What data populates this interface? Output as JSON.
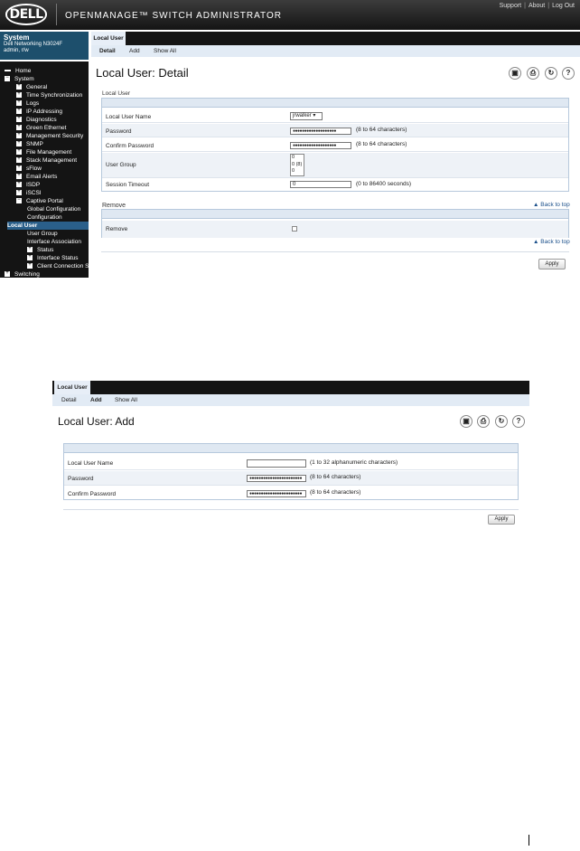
{
  "detail_screen": {
    "header": {
      "logo": "DELL",
      "product_title": "OPENMANAGE™ SWITCH ADMINISTRATOR",
      "links": [
        "Support",
        "About",
        "Log Out"
      ]
    },
    "system_box": {
      "title": "System",
      "device": "Dell Networking N3024F",
      "user": "admin, r/w"
    },
    "nav": [
      {
        "label": "Home",
        "indent": 0,
        "marker": "dash"
      },
      {
        "label": "System",
        "indent": 0,
        "marker": "minus"
      },
      {
        "label": "General",
        "indent": 1,
        "marker": "plus"
      },
      {
        "label": "Time Synchronization",
        "indent": 1,
        "marker": "plus"
      },
      {
        "label": "Logs",
        "indent": 1,
        "marker": "plus"
      },
      {
        "label": "IP Addressing",
        "indent": 1,
        "marker": "plus"
      },
      {
        "label": "Diagnostics",
        "indent": 1,
        "marker": "plus"
      },
      {
        "label": "Green Ethernet",
        "indent": 1,
        "marker": "plus"
      },
      {
        "label": "Management Security",
        "indent": 1,
        "marker": "plus"
      },
      {
        "label": "SNMP",
        "indent": 1,
        "marker": "plus"
      },
      {
        "label": "File Management",
        "indent": 1,
        "marker": "plus"
      },
      {
        "label": "Stack Management",
        "indent": 1,
        "marker": "plus"
      },
      {
        "label": "sFlow",
        "indent": 1,
        "marker": "plus"
      },
      {
        "label": "Email Alerts",
        "indent": 1,
        "marker": "plus"
      },
      {
        "label": "ISDP",
        "indent": 1,
        "marker": "plus"
      },
      {
        "label": "iSCSI",
        "indent": 1,
        "marker": "plus"
      },
      {
        "label": "Captive Portal",
        "indent": 1,
        "marker": "minus"
      },
      {
        "label": "Global Configuration",
        "indent": 2,
        "marker": "none"
      },
      {
        "label": "Configuration",
        "indent": 2,
        "marker": "none"
      },
      {
        "label": "Local User",
        "indent": 2,
        "marker": "none",
        "selected": true
      },
      {
        "label": "User Group",
        "indent": 2,
        "marker": "none"
      },
      {
        "label": "Interface Association",
        "indent": 2,
        "marker": "none"
      },
      {
        "label": "Status",
        "indent": 2,
        "marker": "plus"
      },
      {
        "label": "Interface Status",
        "indent": 2,
        "marker": "plus"
      },
      {
        "label": "Client Connection Status",
        "indent": 2,
        "marker": "plus"
      },
      {
        "label": "Switching",
        "indent": 0,
        "marker": "plus"
      }
    ],
    "tab": "Local User",
    "subtabs": [
      "Detail",
      "Add",
      "Show All"
    ],
    "page_title": "Local User: Detail",
    "section_title": "Local User",
    "fields": {
      "name_label": "Local User Name",
      "name_value": "jrwalker",
      "password_label": "Password",
      "password_hint": "(8 to 64 characters)",
      "confirm_label": "Confirm Password",
      "confirm_hint": "(8 to 64 characters)",
      "group_label": "User Group",
      "group_options": [
        "0",
        "0 (8)",
        "0"
      ],
      "timeout_label": "Session Timeout",
      "timeout_value": "0",
      "timeout_hint": "(0 to 86400 seconds)"
    },
    "masked": "●●●●●●●●●●●●●●●●●●●",
    "remove_section": "Remove",
    "remove_label": "Remove",
    "back_to_top": "Back to top",
    "apply": "Apply"
  },
  "add_screen": {
    "tab": "Local User",
    "subtabs": [
      "Detail",
      "Add",
      "Show All"
    ],
    "page_title": "Local User: Add",
    "fields": {
      "name_label": "Local User Name",
      "name_hint": "(1 to 32 alphanumeric characters)",
      "password_label": "Password",
      "password_hint": "(8 to 64 characters)",
      "confirm_label": "Confirm Password",
      "confirm_hint": "(8 to 64 characters)"
    },
    "masked": "●●●●●●●●●●●●●●●●●●●●●●●",
    "apply": "Apply"
  }
}
